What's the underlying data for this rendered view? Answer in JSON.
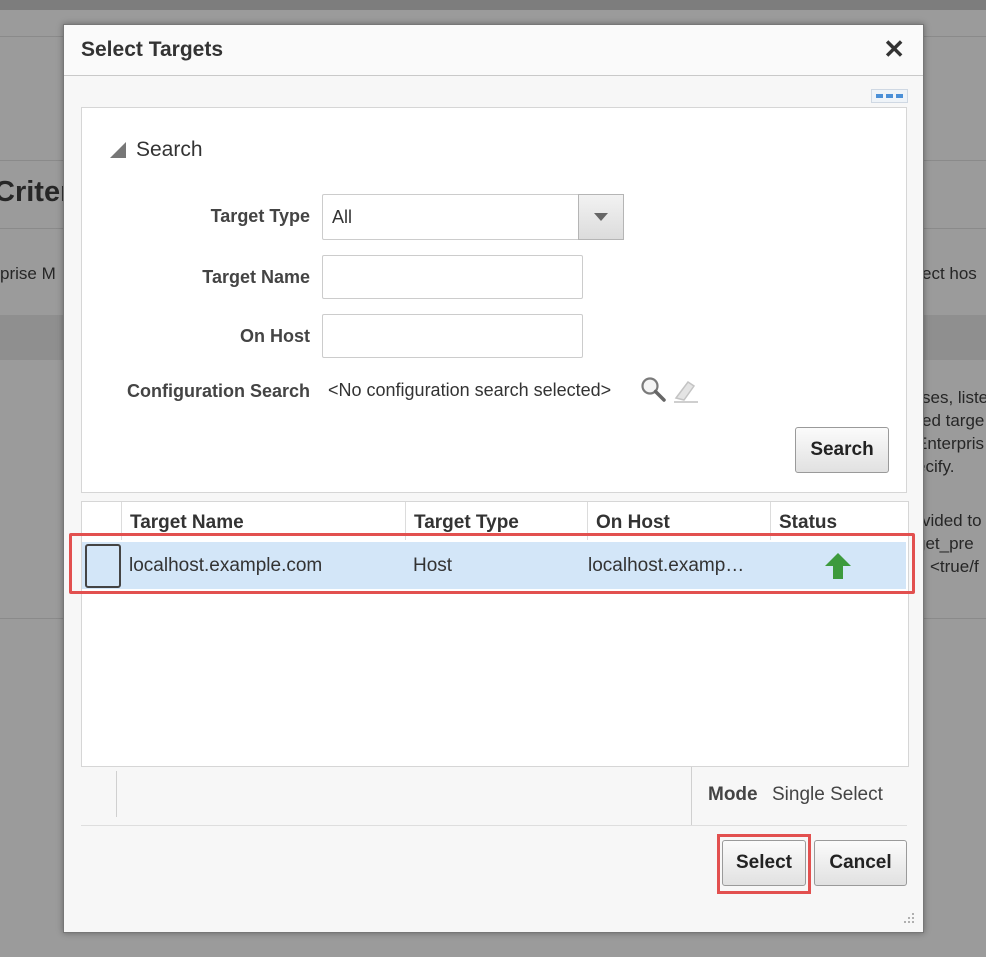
{
  "background": {
    "heading": "Criter",
    "left_snippet": "prise M",
    "right_snippets": [
      "ect hos",
      "ses, liste",
      "ed targe",
      "Enterpris",
      "ecify.",
      "vided to",
      "get_pre",
      "<true/f"
    ]
  },
  "dialog": {
    "title": "Select Targets",
    "close_icon": "close-icon"
  },
  "search": {
    "title": "Search",
    "fields": {
      "target_type_label": "Target Type",
      "target_type_value": "All",
      "target_name_label": "Target Name",
      "target_name_value": "",
      "on_host_label": "On Host",
      "on_host_value": "",
      "config_label": "Configuration Search",
      "config_value": "<No configuration search selected>"
    },
    "search_button": "Search"
  },
  "table": {
    "columns": [
      "Target Name",
      "Target Type",
      "On Host",
      "Status"
    ],
    "rows": [
      {
        "target_name": "localhost.example.com",
        "target_type": "Host",
        "on_host": "localhost.examp…",
        "status": "up-arrow-icon"
      }
    ]
  },
  "footer": {
    "mode_label": "Mode",
    "mode_value": "Single Select",
    "select_button": "Select",
    "cancel_button": "Cancel"
  },
  "colors": {
    "row_selected": "#d3e6f8",
    "highlight": "#e2504f",
    "status_up": "#3d9a3d"
  }
}
